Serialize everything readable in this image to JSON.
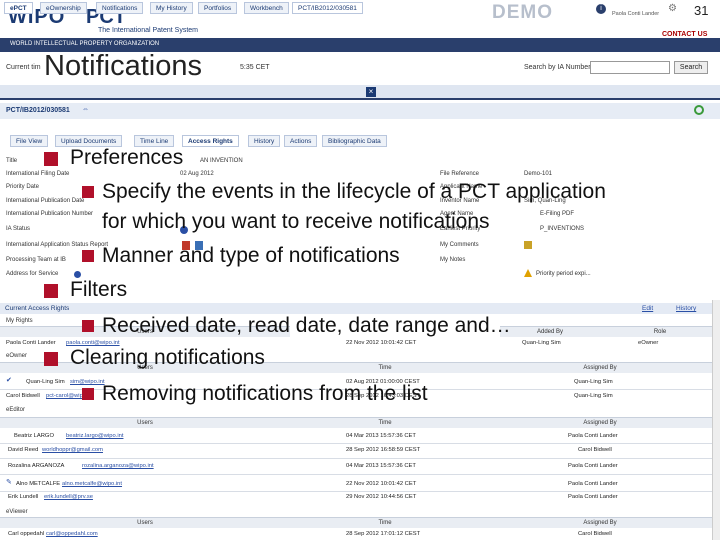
{
  "slide": {
    "number": "31"
  },
  "banner": {
    "wipo": "WIPO",
    "pct": "PCT",
    "pct_sub": "The International Patent System",
    "org": "WORLD INTELLECTUAL PROPERTY ORGANIZATION",
    "demo": "DEMO",
    "user": "Paola Conti Lander",
    "contact": "CONTACT US"
  },
  "header": {
    "current_time_prefix": "Current tim",
    "current_time_suffix": "5:35 CET",
    "search_label": "Search by IA Number",
    "search_button": "Search"
  },
  "nav": {
    "tabs": [
      "ePCT",
      "eOwnership",
      "Notifications",
      "My History",
      "Portfolios",
      "Workbench",
      "PCT/IB2012/030581"
    ]
  },
  "application": {
    "id": "PCT/IB2012/030581",
    "subtabs": [
      "File View",
      "Upload Documents",
      "Time Line",
      "Access Rights",
      "History",
      "Actions",
      "Bibliographic Data"
    ],
    "left_fields": [
      "Title",
      "International Filing Date",
      "Priority Date",
      "International Publication Date",
      "International Publication Number",
      "IA Status",
      "International Application Status Report",
      "Processing Team at IB",
      "Address for Service"
    ],
    "left_values": [
      "AN INVENTION",
      "02 Aug 2012",
      "",
      "",
      "",
      "",
      "",
      "",
      ""
    ],
    "right_fields": [
      "File Reference",
      "Applicant Name",
      "Inventor Name",
      "Agent Name",
      "Earliest Priority",
      "Last Publication",
      "My Comments",
      "My Notes"
    ],
    "right_values": [
      "Demo-101",
      "",
      "Sim, Quan-Ling",
      "",
      "E-Filing PDF",
      "P_INVENTIONS",
      "",
      "Priority period expi..."
    ]
  },
  "access_rights": {
    "title": "Current Access Rights",
    "edit": "Edit",
    "history": "History",
    "my_rights": {
      "label": "My Rights",
      "headers": [
        "Users",
        "Added By",
        "Role"
      ],
      "row": {
        "user": "Paola Conti Lander",
        "email": "paola.conti@wipo.int",
        "time": "22 Nov 2012 10:01:42 CET",
        "added_by": "Quan-Ling Sim",
        "role": "eOwner"
      }
    },
    "eowner": {
      "label": "eOwner",
      "headers": [
        "Users",
        "Time",
        "Assigned By"
      ],
      "rows": [
        {
          "user": "Quan-Ling Sim",
          "email": "sim@wipo.int",
          "time": "02 Aug 2012 01:00:00 CEST",
          "assigned_by": "Quan-Ling Sim"
        },
        {
          "user": "Carol Bidwell",
          "email": "pct-carol@wipo.int",
          "time": "28 Sep 2012 16:43:03 CEST",
          "assigned_by": "Quan-Ling Sim"
        }
      ]
    },
    "eeditor": {
      "label": "eEditor",
      "headers": [
        "Users",
        "Time",
        "Assigned By"
      ],
      "rows": [
        {
          "user": "Beatriz LARGO",
          "email": "beatriz.largo@wipo.int",
          "time": "04 Mar 2013 15:57:36 CET",
          "assigned_by": "Paola Conti Lander"
        },
        {
          "user": "David Reed",
          "email": "worldhoppr@gmail.com",
          "time": "28 Sep 2012 16:58:59 CEST",
          "assigned_by": "Carol Bidwell"
        },
        {
          "user": "Rozalina ARGANOZA",
          "email": "rozalina.arganoza@wipo.int",
          "time": "04 Mar 2013 15:57:36 CET",
          "assigned_by": "Paola Conti Lander"
        },
        {
          "user": "Alno METCALFE",
          "email": "alno.metcalfe@wipo.int",
          "time": "22 Nov 2012 10:01:42 CET",
          "assigned_by": "Paola Conti Lander"
        },
        {
          "user": "Erik Lundell",
          "email": "erik.lundell@prv.se",
          "time": "29 Nov 2012 10:44:56 CET",
          "assigned_by": "Paola Conti Lander"
        }
      ]
    },
    "eviewer": {
      "label": "eViewer",
      "headers": [
        "Users",
        "Time",
        "Assigned By"
      ],
      "rows": [
        {
          "user": "Carl oppedahl",
          "email": "carl@oppedahl.com",
          "time": "28 Sep 2012 17:01:12 CEST",
          "assigned_by": "Carol Bidwell"
        }
      ]
    }
  },
  "overlay": {
    "title": "Notifications",
    "items": [
      {
        "level": 1,
        "text": "Preferences"
      },
      {
        "level": 2,
        "text": "Specify the events in the lifecycle of a PCT application"
      },
      {
        "level": 2,
        "text": "for which you want to receive notifications",
        "continuation": true
      },
      {
        "level": 2,
        "text": "Manner and type of notifications"
      },
      {
        "level": 1,
        "text": "Filters"
      },
      {
        "level": 2,
        "text": "Received date, read date, date range and…"
      },
      {
        "level": 1,
        "text": "Clearing notifications"
      },
      {
        "level": 2,
        "text": "Removing notifications from the list"
      }
    ]
  },
  "colors": {
    "accent": "#b0102a",
    "brand": "#1b3a73",
    "bar": "#2a3f6c"
  }
}
